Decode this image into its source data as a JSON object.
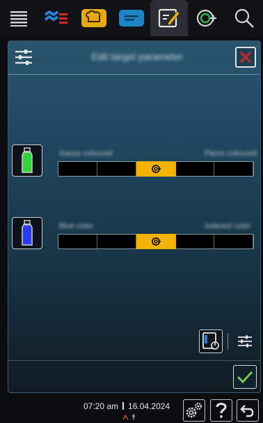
{
  "nav": {
    "tabs": [
      {
        "icon": "menu-list-icon"
      },
      {
        "icon": "cooking-steam-icon"
      },
      {
        "icon": "chef-hat-icon"
      },
      {
        "icon": "blue-tray-icon"
      },
      {
        "icon": "edit-note-icon",
        "active": true
      },
      {
        "icon": "icombi-plus-icon"
      },
      {
        "icon": "search-icon"
      }
    ]
  },
  "panel": {
    "title": "Edit target parameter"
  },
  "rows": [
    {
      "icon": "green-bottle-icon",
      "label_left": "Sauce coloured",
      "label_right": "Pierre coloured",
      "bottle_color": "#35d13a"
    },
    {
      "icon": "blue-bottle-icon",
      "label_left": "Blue color",
      "label_right": "Indexed color",
      "bottle_color": "#2a3cf0"
    }
  ],
  "status": {
    "time": "07:20 am",
    "date": "16.04.2024"
  },
  "colors": {
    "accent": "#f3b100",
    "close": "#d9211f",
    "ok": "#7ac74f"
  }
}
